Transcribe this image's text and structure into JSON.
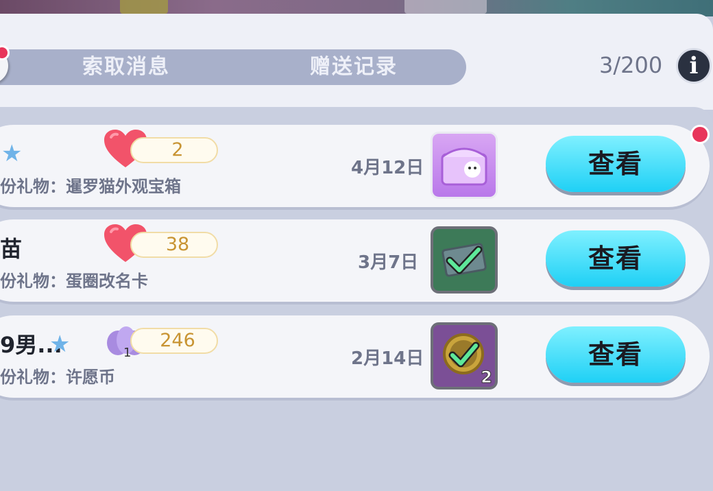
{
  "tabs": {
    "tab1": "索取消息",
    "tab2": "赠送记录"
  },
  "counter": "3/200",
  "info_icon_label": "i",
  "records": [
    {
      "name": "",
      "has_star": true,
      "currency_icon": "heart-icon",
      "amount": "2",
      "gift_text": "份礼物：暹罗猫外观宝箱",
      "date": "4月12日",
      "item_icon": "treasure-chest-icon",
      "item_count": "",
      "button": "查看",
      "new_badge": true
    },
    {
      "name": "苗",
      "has_star": false,
      "currency_icon": "heart-icon",
      "amount": "38",
      "gift_text": "份礼物：蛋圈改名卡",
      "date": "3月7日",
      "item_icon": "rename-card-icon",
      "item_count": "",
      "button": "查看",
      "new_badge": false
    },
    {
      "name": "9男...",
      "has_star": true,
      "currency_icon": "shell-icon",
      "shell_level": "1",
      "amount": "246",
      "gift_text": "份礼物：许愿币",
      "date": "2月14日",
      "item_icon": "wish-coin-icon",
      "item_count": "2",
      "button": "查看",
      "new_badge": false
    }
  ],
  "colors": {
    "button_gradient_top": "#7ff0ff",
    "button_gradient_bottom": "#1fd0f5",
    "amount_text": "#c89433",
    "badge_red": "#e8355a"
  }
}
